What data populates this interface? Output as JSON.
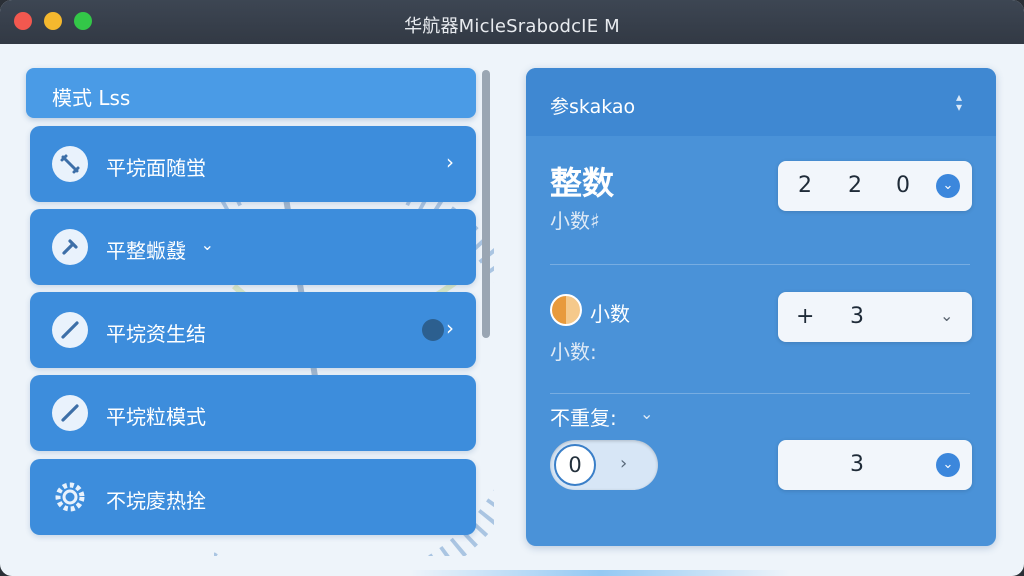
{
  "window": {
    "title": "华航器MicleSrabodcIE M"
  },
  "sidebar": {
    "header_label": "模式 Lss",
    "items": [
      {
        "label": "平垸面随蛍",
        "icon": "wrench-icon",
        "accessory": "›"
      },
      {
        "label": "平整蝂鼗",
        "icon": "hammer-icon",
        "accessory": "⌄"
      },
      {
        "label": "平垸资生结",
        "icon": "pencil-icon",
        "accessory": "›"
      },
      {
        "label": "平垸粒模式",
        "icon": "pencil-icon",
        "accessory": ""
      },
      {
        "label": "不垸庱热拴",
        "icon": "gear-icon",
        "accessory": ""
      }
    ]
  },
  "panel": {
    "header_label": "参skakao",
    "integer": {
      "title": "整数",
      "subtitle": "小数♯",
      "digits": [
        "2",
        "2",
        "0"
      ]
    },
    "decimal": {
      "title": "小数",
      "subtitle": "小数:",
      "sign": "+",
      "value": "3"
    },
    "repeat": {
      "title": "不重复:",
      "caret": "⌄",
      "toggle_value": "0",
      "value": "3"
    }
  }
}
